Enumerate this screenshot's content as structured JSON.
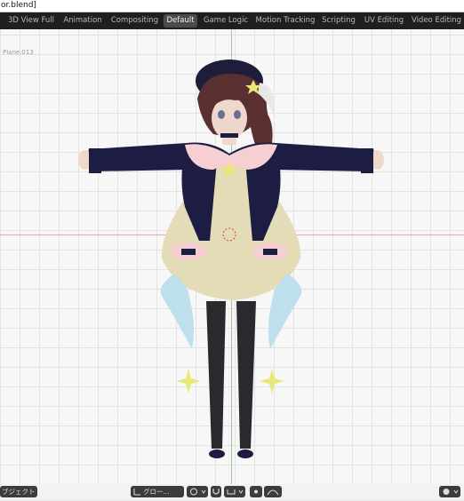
{
  "window": {
    "title": "or.blend]"
  },
  "workspaces": {
    "tabs": [
      {
        "label": "3D View Full",
        "active": false
      },
      {
        "label": "Animation",
        "active": false
      },
      {
        "label": "Compositing",
        "active": false
      },
      {
        "label": "Default",
        "active": true
      },
      {
        "label": "Game Logic",
        "active": false
      },
      {
        "label": "Motion Tracking",
        "active": false
      },
      {
        "label": "Scripting",
        "active": false
      },
      {
        "label": "UV Editing",
        "active": false
      },
      {
        "label": "Video Editing",
        "active": false
      }
    ]
  },
  "viewport": {
    "active_object": "Plane.013",
    "icon": "character-model"
  },
  "toolbar": {
    "mode_label": "ブジェクト",
    "orientation_label": "グロー...",
    "orientation_icon": "orientation-icon",
    "pivot_icon": "pivot-icon",
    "snap_icon": "magnet-icon",
    "snap_mode_icon": "snap-increment-icon",
    "proportional_icon": "proportional-edit-icon",
    "falloff_icon": "falloff-curve-icon",
    "overlay_icon": "overlay-icon"
  },
  "colors": {
    "tab_bar": "#1f1f1f",
    "tab_active": "#4a4a4a",
    "x_axis": "#e5a9a9",
    "y_axis": "#9fc6a7",
    "jacket": "#1d1d44",
    "collar": "#f6cfd3",
    "skirt": "#e4dcb6",
    "ribbon": "#bde0ec",
    "stockings": "#2a2a2e",
    "hair": "#5a2f2f",
    "star": "#e8e87a"
  }
}
